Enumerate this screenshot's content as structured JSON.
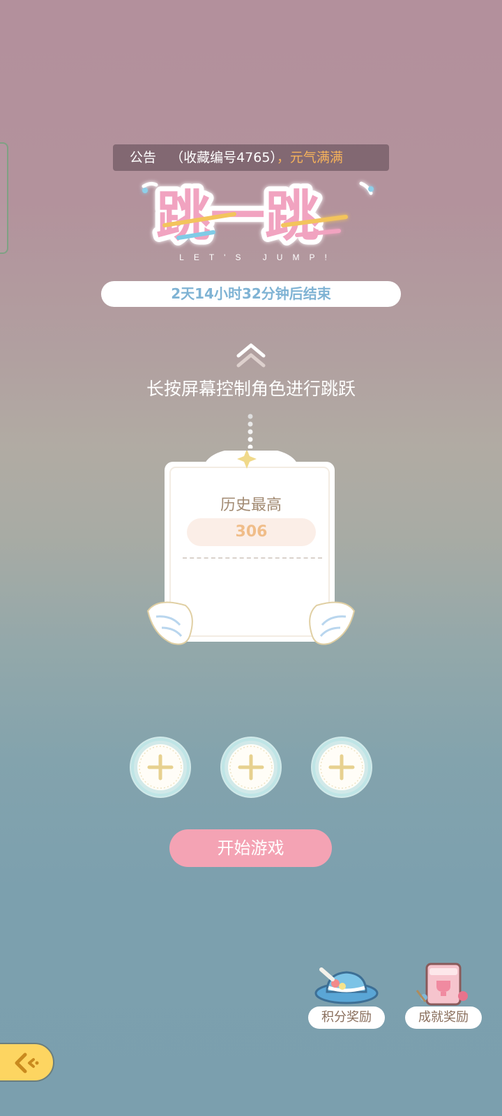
{
  "notice": {
    "label": "公告",
    "text": "（收藏编号4765）",
    "highlight": "，元气满满"
  },
  "logo": {
    "title": "跳一跳",
    "subtitle": "LET'S JUMP!"
  },
  "timer": "2天14小时32分钟后结束",
  "hint": "长按屏幕控制角色进行跳跃",
  "score_card": {
    "label": "历史最高",
    "value": "306"
  },
  "slots": [
    "add-slot",
    "add-slot",
    "add-slot"
  ],
  "start_button": "开始游戏",
  "rewards": [
    {
      "label": "积分奖励",
      "icon": "hat-icon"
    },
    {
      "label": "成就奖励",
      "icon": "trophy-box-icon"
    }
  ],
  "back_button": {
    "icon": "back-arrow-icon"
  },
  "colors": {
    "accent_pink": "#f4a3b4",
    "timer_text": "#7fb3d4",
    "score_text": "#f0bd89",
    "back_button": "#fdd561",
    "highlight": "#f5b25b"
  }
}
